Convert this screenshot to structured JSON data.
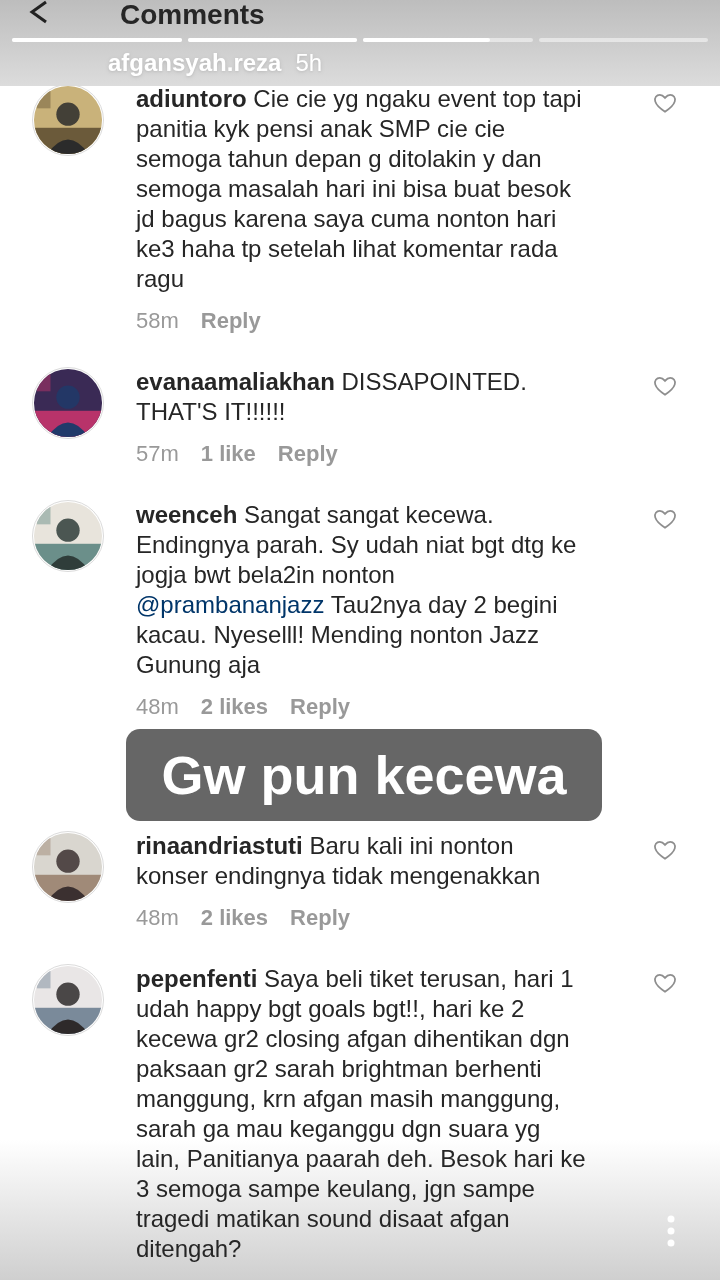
{
  "story": {
    "progress": [
      {
        "level": 1
      },
      {
        "level": 1
      },
      {
        "level": 0.75
      },
      {
        "level": 0
      }
    ],
    "user": "afgansyah.reza",
    "time": "5h"
  },
  "header": {
    "title": "Comments"
  },
  "comments": [
    {
      "username": "adiuntoro",
      "segments": [
        {
          "kind": "text",
          "text": "Cie cie yg ngaku event top tapi panitia kyk pensi anak SMP cie cie semoga tahun depan g ditolakin y dan semoga masalah hari ini bisa buat besok jd bagus karena saya cuma nonton hari ke3 haha tp setelah lihat komentar rada ragu"
        }
      ],
      "time": "58m",
      "reply": "Reply"
    },
    {
      "username": "evanaamaliakhan",
      "segments": [
        {
          "kind": "text",
          "text": "DISSAPOINTED. THAT'S IT!!!!!!"
        }
      ],
      "time": "57m",
      "likes": "1 like",
      "reply": "Reply"
    },
    {
      "username": "weenceh",
      "segments": [
        {
          "kind": "text",
          "text": "Sangat sangat kecewa. Endingnya parah. Sy udah niat bgt dtg ke jogja bwt bela2in nonton "
        },
        {
          "kind": "mention",
          "text": "@prambananjazz"
        },
        {
          "kind": "text",
          "text": "  Tau2nya day 2 begini kacau. Nyeselll! Mending nonton Jazz Gunung aja"
        }
      ],
      "time": "48m",
      "likes": "2 likes",
      "reply": "Reply"
    },
    {
      "username": "rinaandriastuti",
      "segments": [
        {
          "kind": "text",
          "text": "Baru kali ini nonton konser endingnya tidak mengenakkan"
        }
      ],
      "time": "48m",
      "likes": "2 likes",
      "reply": "Reply"
    },
    {
      "username": "pepenfenti",
      "segments": [
        {
          "kind": "text",
          "text": "Saya beli tiket terusan, hari 1 udah happy bgt goals bgt!!, hari ke 2 kecewa gr2 closing afgan dihentikan dgn paksaan gr2 sarah brightman berhenti manggung,  krn afgan masih manggung, sarah ga mau keganggu dgn suara yg lain, Panitianya paarah deh.  Besok hari ke 3 semoga sampe keulang,  jgn sampe tragedi matikan sound disaat afgan ditengah?"
        }
      ]
    }
  ],
  "sticker": {
    "text": "Gw pun kecewa"
  }
}
